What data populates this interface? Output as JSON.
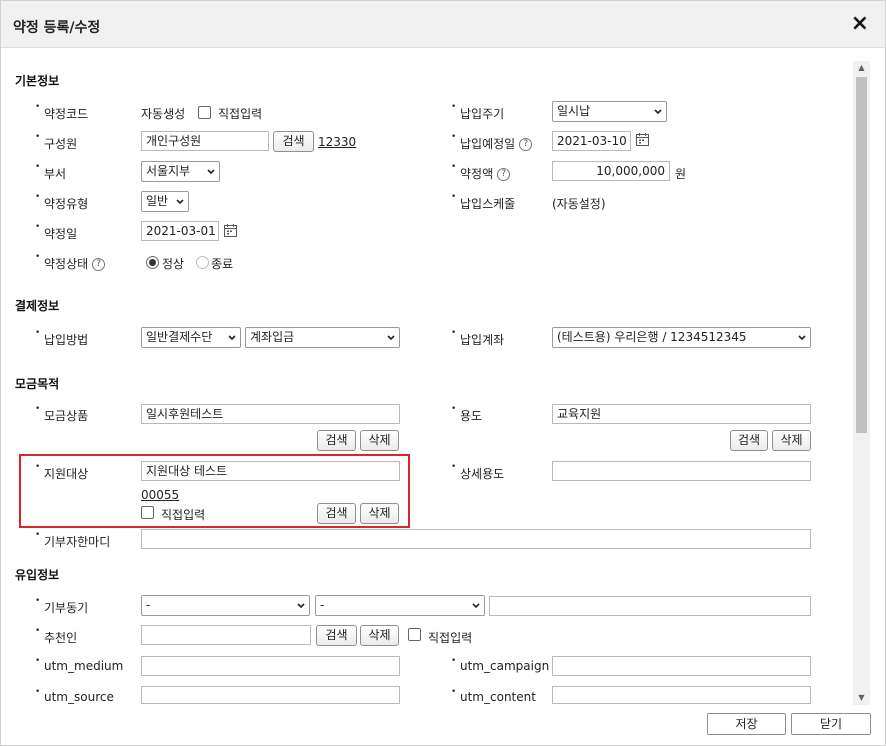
{
  "dialog": {
    "title": "약정 등록/수정"
  },
  "sections": {
    "basic": "기본정보",
    "payment": "결제정보",
    "purpose": "모금목적",
    "inflow": "유입정보"
  },
  "basic": {
    "code_label": "약정코드",
    "code_auto": "자동생성",
    "code_direct": "직접입력",
    "member_label": "구성원",
    "member_value": "개인구성원",
    "member_search": "검색",
    "member_id": "12330",
    "dept_label": "부서",
    "dept_value": "서울지부",
    "type_label": "약정유형",
    "type_value": "일반",
    "date_label": "약정일",
    "date_value": "2021-03-01",
    "status_label": "약정상태",
    "status_normal": "정상",
    "status_end": "종료",
    "cycle_label": "납입주기",
    "cycle_value": "일시납",
    "due_label": "납입예정일",
    "due_value": "2021-03-10",
    "amount_label": "약정액",
    "amount_value": "10,000,000",
    "amount_unit": "원",
    "schedule_label": "납입스케줄",
    "schedule_value": "(자동설정)",
    "help_glyph": "?"
  },
  "payment": {
    "method_label": "납입방법",
    "method_value": "일반결제수단",
    "method2_value": "계좌입금",
    "account_label": "납입계좌",
    "account_value": "(테스트용) 우리은행 / 1234512345"
  },
  "purpose": {
    "product_label": "모금상품",
    "product_value": "일시후원테스트",
    "usage_label": "용도",
    "usage_value": "교육지원",
    "target_label": "지원대상",
    "target_value": "지원대상 테스트",
    "target_id": "00055",
    "target_direct": "직접입력",
    "detail_label": "상세용도",
    "detail_value": "",
    "message_label": "기부자한마디",
    "message_value": "",
    "search": "검색",
    "delete": "삭제"
  },
  "inflow": {
    "motive_label": "기부동기",
    "motive1_value": "-",
    "motive2_value": "-",
    "motive3_value": "",
    "referrer_label": "추천인",
    "referrer_value": "",
    "referrer_direct": "직접입력",
    "utm_medium_label": "utm_medium",
    "utm_campaign_label": "utm_campaign",
    "utm_source_label": "utm_source",
    "utm_content_label": "utm_content",
    "search": "검색",
    "delete": "삭제"
  },
  "footer": {
    "save": "저장",
    "close": "닫기"
  },
  "icons": {
    "close": "×",
    "scroll_up": "▲",
    "scroll_down": "▼"
  },
  "colors": {
    "highlight": "#d9262c"
  }
}
